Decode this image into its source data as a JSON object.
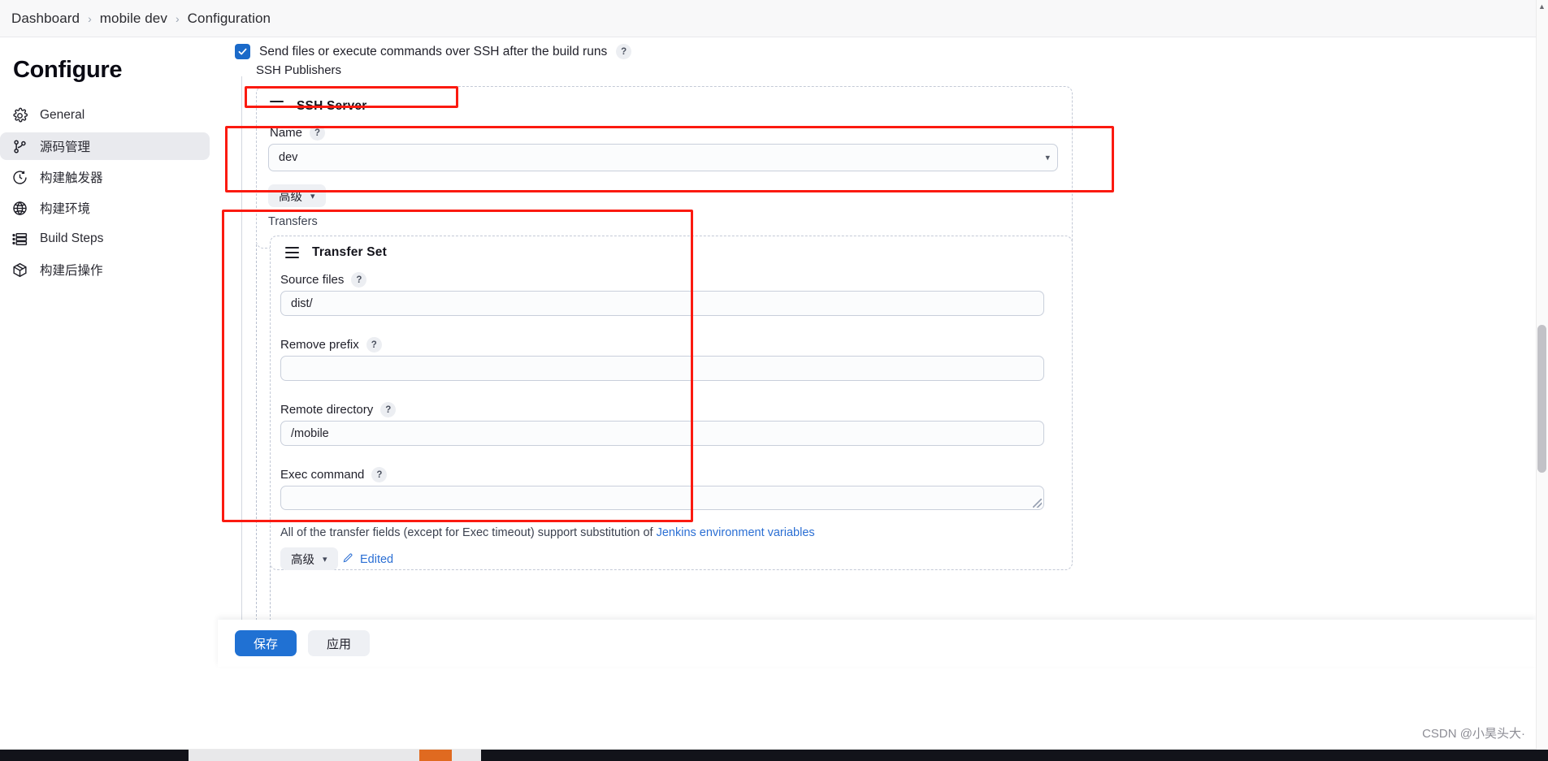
{
  "breadcrumb": {
    "items": [
      "Dashboard",
      "mobile dev",
      "Configuration"
    ],
    "separator": "›"
  },
  "sidebar": {
    "title": "Configure",
    "items": [
      {
        "label": "General",
        "icon": "gear-icon",
        "active": false
      },
      {
        "label": "源码管理",
        "icon": "source-branch-icon",
        "active": true
      },
      {
        "label": "构建触发器",
        "icon": "clock-icon",
        "active": false
      },
      {
        "label": "构建环境",
        "icon": "globe-icon",
        "active": false
      },
      {
        "label": "Build Steps",
        "icon": "list-icon",
        "active": false
      },
      {
        "label": "构建后操作",
        "icon": "package-icon",
        "active": false
      }
    ]
  },
  "main": {
    "ssh_checkbox": {
      "label": "Send files or execute commands over SSH after the build runs",
      "checked": true,
      "help": "?"
    },
    "publishers_label": "SSH Publishers",
    "ssh_server": {
      "title": "SSH Server",
      "name_label": "Name",
      "name_help": "?",
      "name_value": "dev",
      "name_options": [
        "dev"
      ],
      "advanced_label": "高级"
    },
    "transfers": {
      "label": "Transfers",
      "transfer_set": {
        "title": "Transfer Set",
        "fields": [
          {
            "label": "Source files",
            "help": "?",
            "value": "dist/",
            "type": "input"
          },
          {
            "label": "Remove prefix",
            "help": "?",
            "value": "",
            "type": "input"
          },
          {
            "label": "Remote directory",
            "help": "?",
            "value": "/mobile",
            "type": "input"
          },
          {
            "label": "Exec command",
            "help": "?",
            "value": "",
            "type": "textarea"
          }
        ],
        "hint_prefix": "All of the transfer fields (except for Exec timeout) support substitution of ",
        "hint_link": "Jenkins environment variables",
        "advanced_label": "高级",
        "edited_label": "Edited"
      }
    }
  },
  "footer": {
    "save_label": "保存",
    "apply_label": "应用"
  },
  "watermark": "CSDN @小昊头大·",
  "colors": {
    "accent": "#2071d3",
    "checkbox": "#1b6ac9",
    "link": "#2b6fd4",
    "annotation": "#fb1a10",
    "active_nav": "#e9eaee"
  }
}
